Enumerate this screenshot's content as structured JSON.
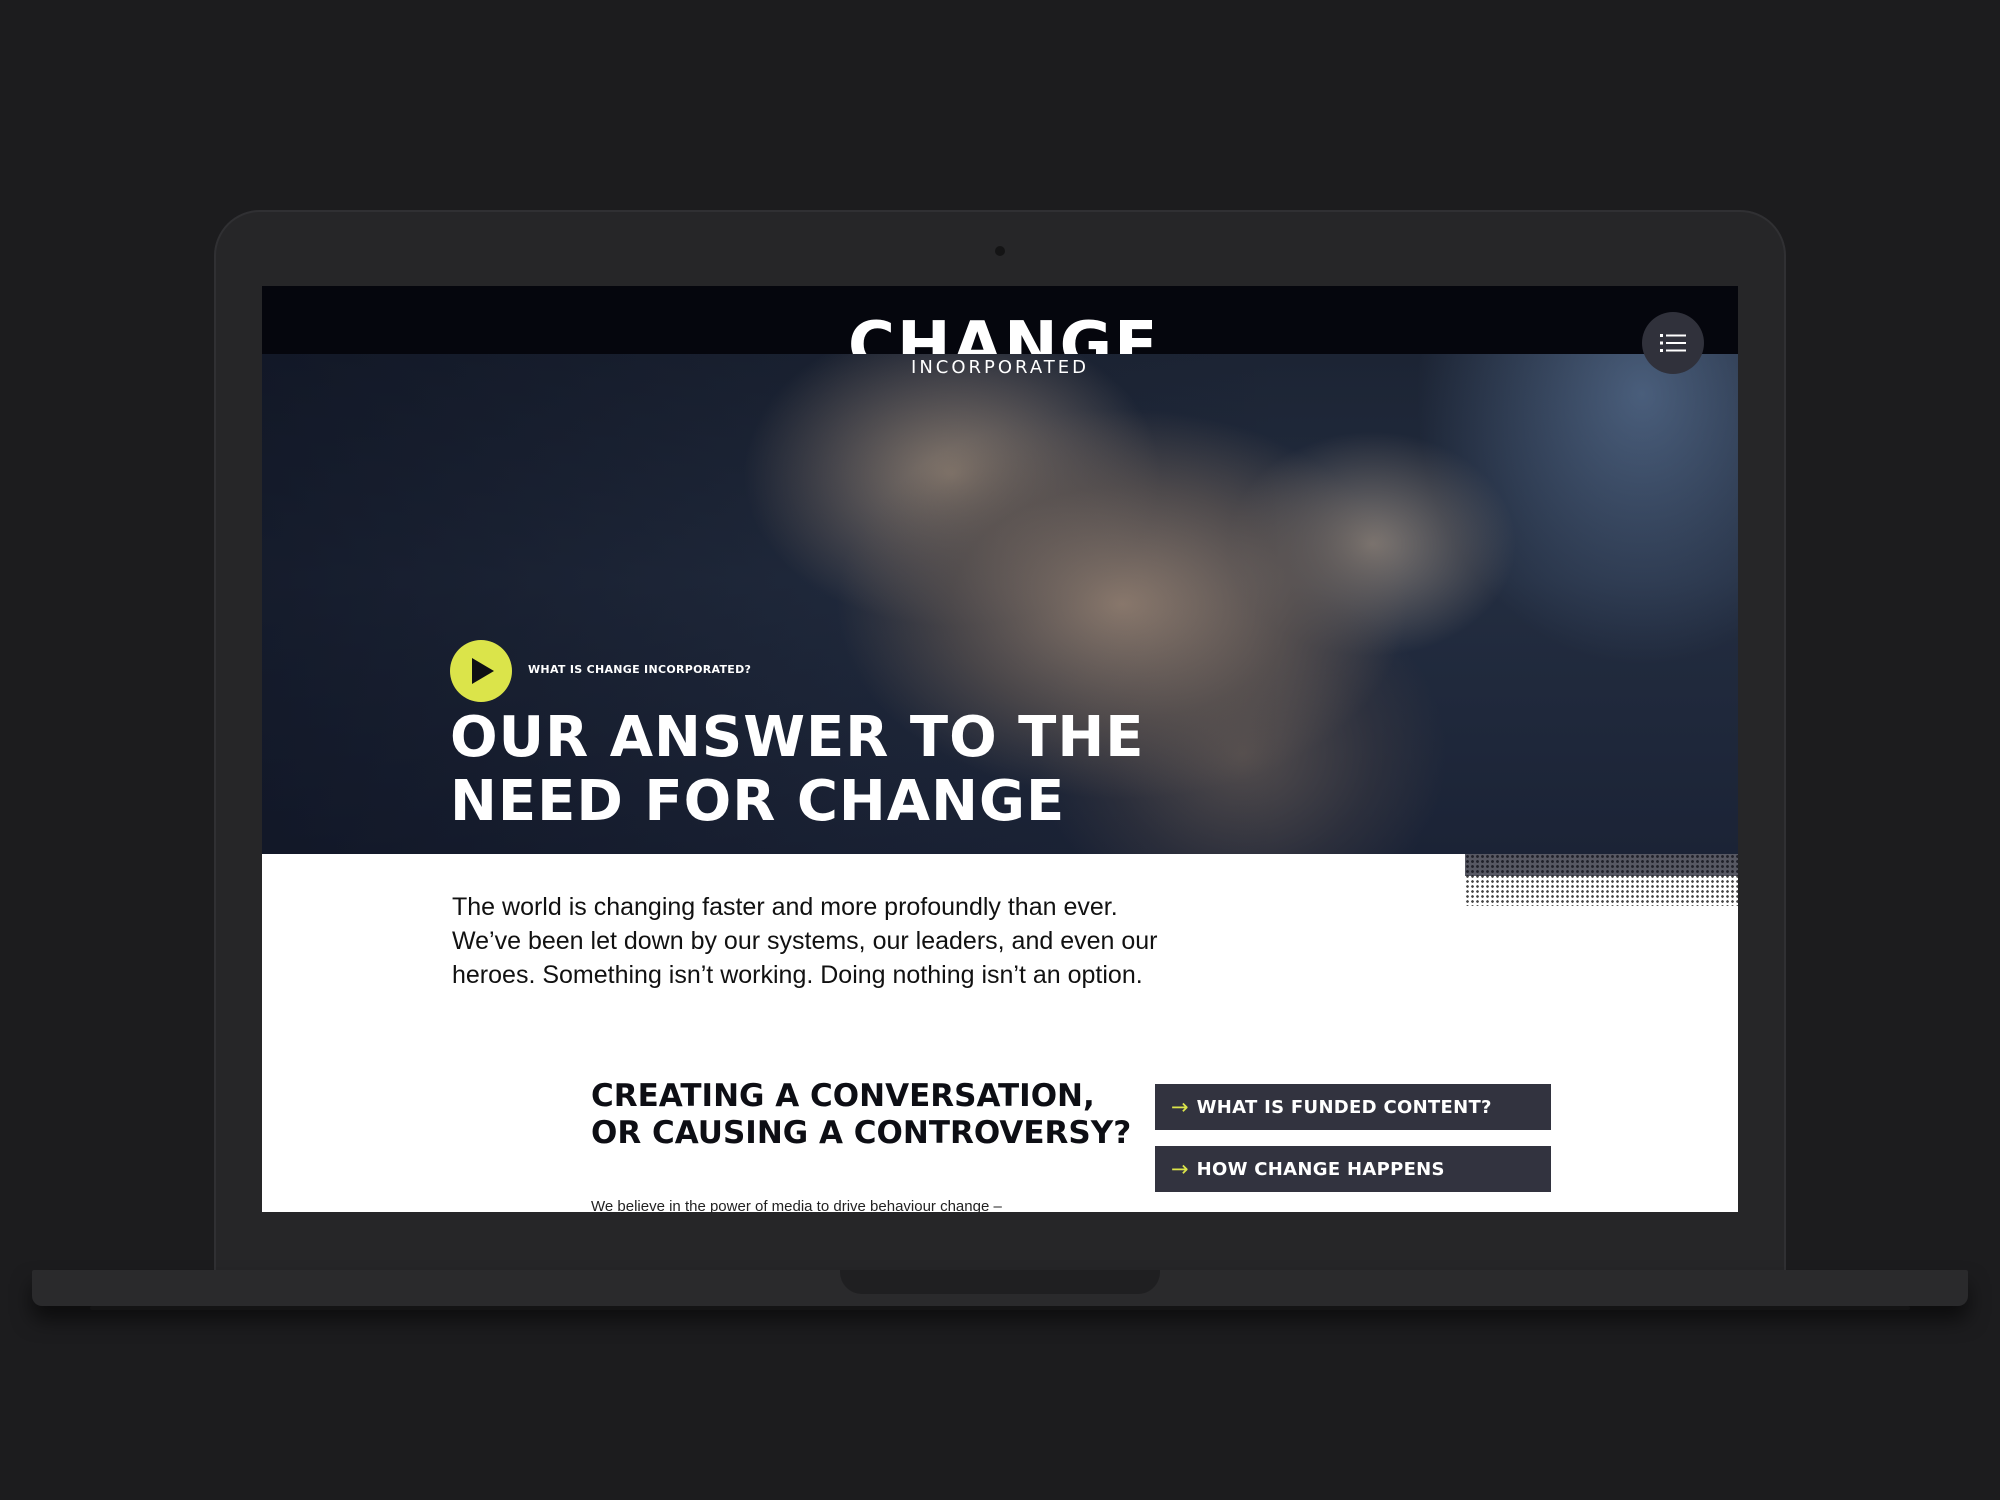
{
  "site": {
    "logo": {
      "main": "CHANGE",
      "sub": "INCORPORATED"
    }
  },
  "header": {
    "menu_icon": "list-icon"
  },
  "hero": {
    "play_icon": "play-icon",
    "play_label": "WHAT IS CHANGE INCORPORATED?",
    "title_lines": [
      "OUR ANSWER TO THE",
      "NEED FOR CHANGE"
    ]
  },
  "intro": {
    "lines": [
      "The world is changing faster and more profoundly than ever.",
      "We’ve been let down by our systems, our leaders, and even our",
      "heroes. Something isn’t working. Doing nothing isn’t an option."
    ]
  },
  "section": {
    "title_lines": [
      "CREATING A CONVERSATION,",
      "OR CAUSING A CONTROVERSY?"
    ],
    "body_start": "We believe in the power of media to drive behaviour change –"
  },
  "links": [
    {
      "label": "WHAT IS FUNDED CONTENT?",
      "icon": "arrow-right-icon"
    },
    {
      "label": "HOW CHANGE HAPPENS",
      "icon": "arrow-right-icon"
    }
  ],
  "colors": {
    "accent": "#dbe44a",
    "dark": "#05060d",
    "button": "#32333f"
  }
}
